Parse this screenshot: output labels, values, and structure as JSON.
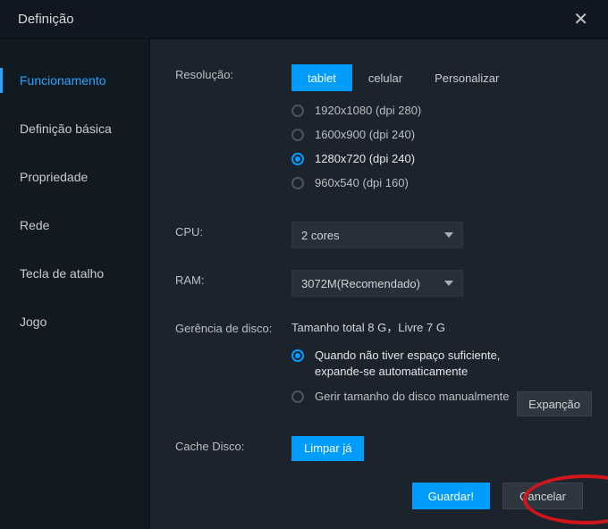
{
  "window": {
    "title": "Definição"
  },
  "sidebar": {
    "items": [
      {
        "label": "Funcionamento",
        "active": true
      },
      {
        "label": "Definição básica",
        "active": false
      },
      {
        "label": "Propriedade",
        "active": false
      },
      {
        "label": "Rede",
        "active": false
      },
      {
        "label": "Tecla de atalho",
        "active": false
      },
      {
        "label": "Jogo",
        "active": false
      }
    ]
  },
  "resolution": {
    "label": "Resolução:",
    "segments": [
      {
        "label": "tablet",
        "active": true
      },
      {
        "label": "celular",
        "active": false
      },
      {
        "label": "Personalizar",
        "active": false
      }
    ],
    "options": [
      {
        "label": "1920x1080  (dpi 280)",
        "selected": false
      },
      {
        "label": "1600x900  (dpi 240)",
        "selected": false
      },
      {
        "label": "1280x720  (dpi 240)",
        "selected": true
      },
      {
        "label": "960x540  (dpi 160)",
        "selected": false
      }
    ]
  },
  "cpu": {
    "label": "CPU:",
    "value": "2 cores"
  },
  "ram": {
    "label": "RAM:",
    "value": "3072M(Recomendado)"
  },
  "disk": {
    "label": "Gerência de disco:",
    "info": "Tamanho total 8 G，Livre 7 G",
    "options": [
      {
        "label": "Quando não tiver espaço suficiente, expande-se automaticamente",
        "selected": true
      },
      {
        "label": "Gerir tamanho do disco manualmente",
        "selected": false
      }
    ],
    "expand_btn": "Expanção"
  },
  "cache": {
    "label": "Cache Disco:",
    "button": "Limpar já"
  },
  "footer": {
    "save": "Guardar!",
    "cancel": "Cancelar"
  }
}
